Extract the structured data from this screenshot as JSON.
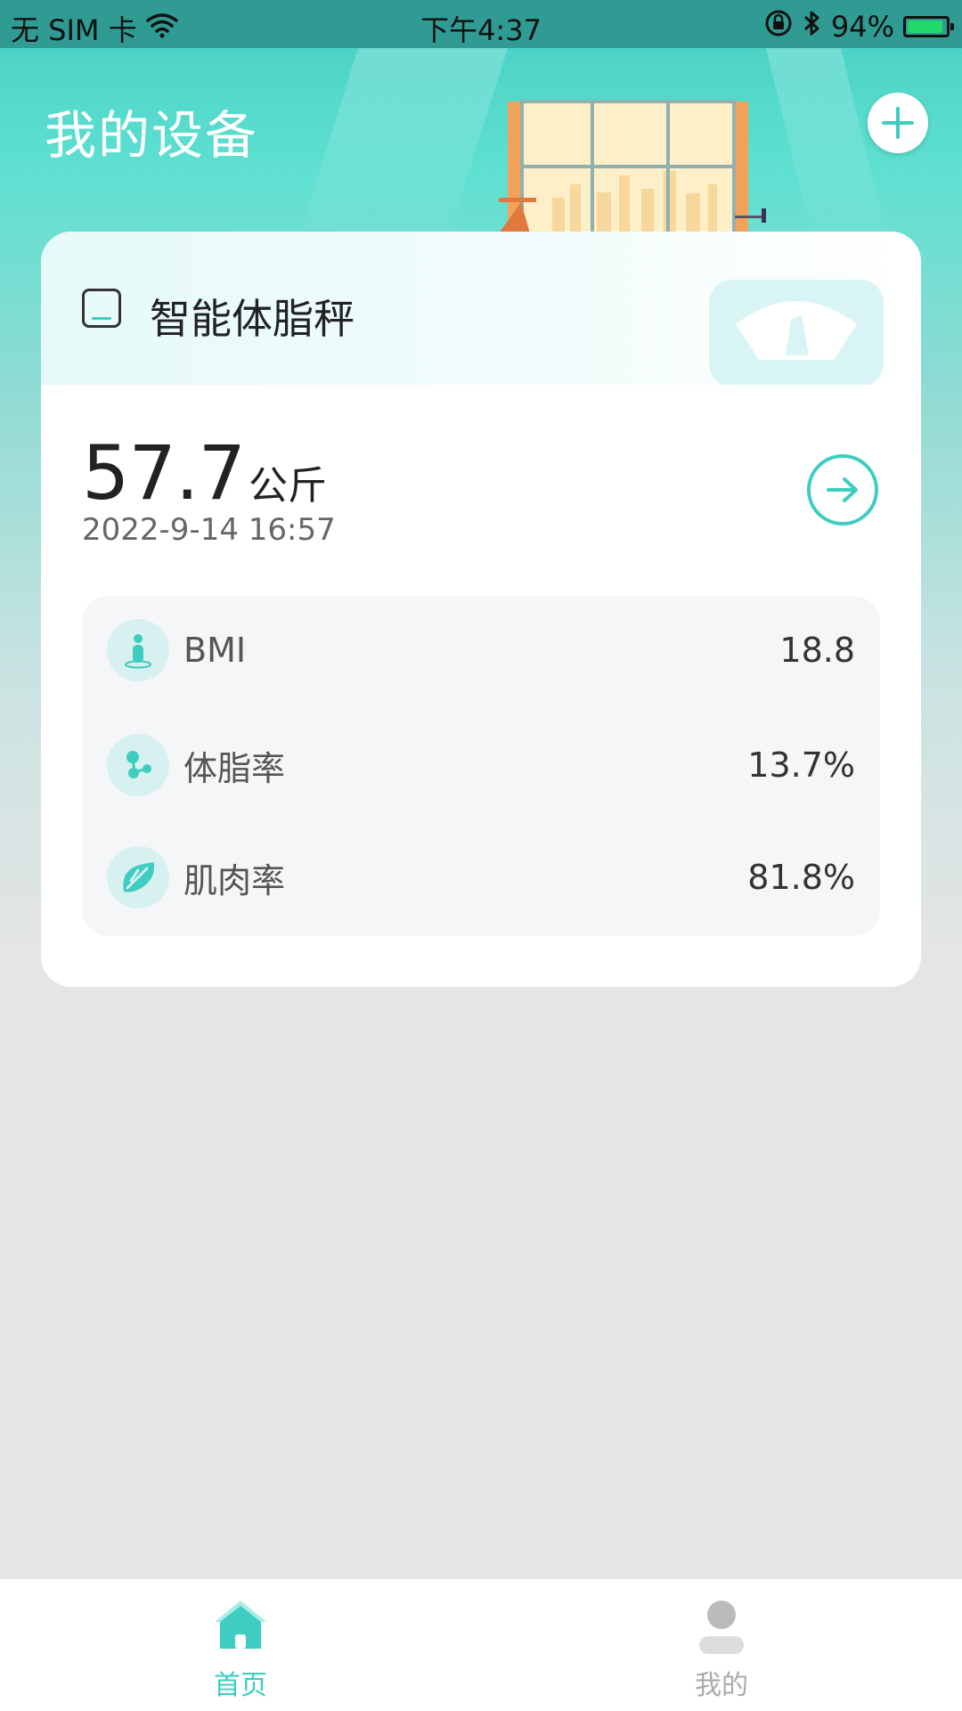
{
  "status_bar": {
    "carrier": "无 SIM 卡",
    "time": "下午4:37",
    "battery_percent": "94%",
    "battery_level": 0.94
  },
  "header": {
    "title": "我的设备",
    "add_icon": "plus-icon"
  },
  "device": {
    "name": "智能体脂秤",
    "weight": "57.7",
    "unit": "公斤",
    "date": "2022-9-14 16:57",
    "metrics": [
      {
        "label": "BMI",
        "value": "18.8",
        "icon": "person-icon"
      },
      {
        "label": "体脂率",
        "value": "13.7%",
        "icon": "molecule-icon"
      },
      {
        "label": "肌肉率",
        "value": "81.8%",
        "icon": "leaf-icon"
      }
    ]
  },
  "tabs": [
    {
      "label": "首页",
      "icon": "home-icon",
      "active": true
    },
    {
      "label": "我的",
      "icon": "profile-icon",
      "active": false
    }
  ],
  "colors": {
    "accent": "#3ecdc0",
    "header_teal": "#45cfc3",
    "inactive": "#aaaaaa"
  }
}
